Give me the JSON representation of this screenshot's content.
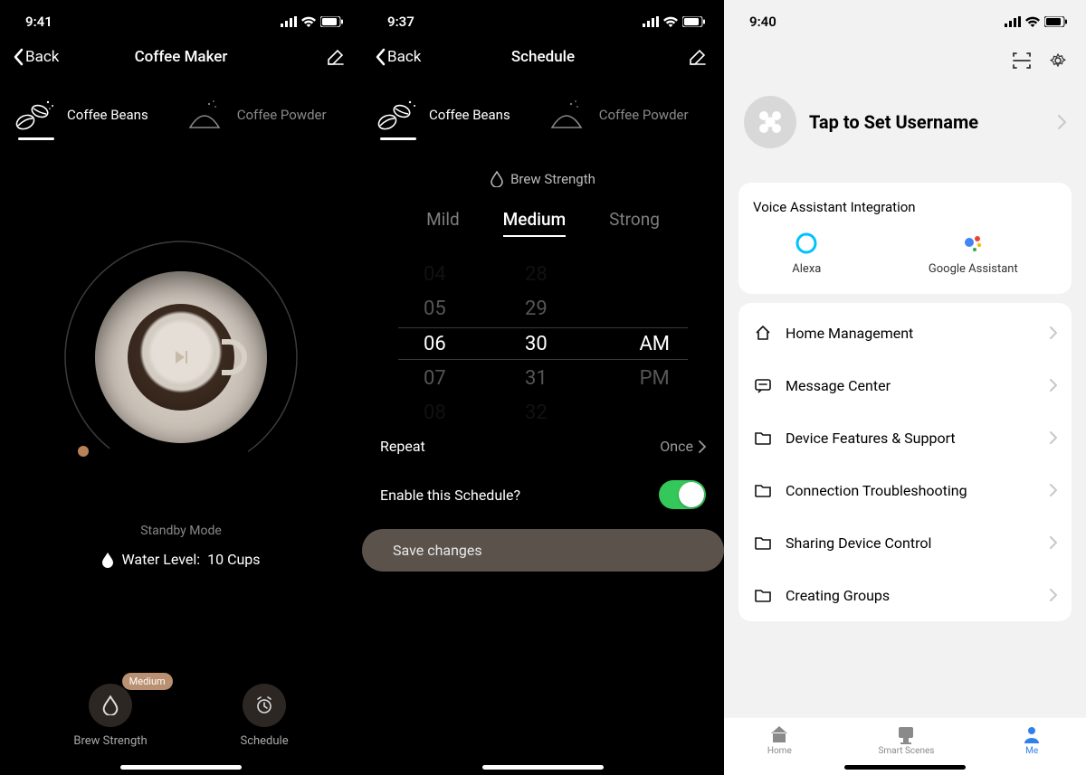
{
  "screens": {
    "coffee": {
      "time": "9:41",
      "back": "Back",
      "title": "Coffee Maker",
      "type_tabs": {
        "beans": "Coffee Beans",
        "powder": "Coffee Powder",
        "active": "beans"
      },
      "status": "Standby Mode",
      "water_label": "Water Level:",
      "water_value": "10 Cups",
      "actions": {
        "brew": "Brew Strength",
        "brew_badge": "Medium",
        "schedule": "Schedule"
      }
    },
    "schedule": {
      "time": "9:37",
      "back": "Back",
      "title": "Schedule",
      "type_tabs": {
        "beans": "Coffee Beans",
        "powder": "Coffee Powder",
        "active": "beans"
      },
      "strength_label": "Brew Strength",
      "strengths": {
        "mild": "Mild",
        "medium": "Medium",
        "strong": "Strong",
        "active": "medium"
      },
      "picker": {
        "hours": [
          "04",
          "05",
          "06",
          "07",
          "08"
        ],
        "mins": [
          "28",
          "29",
          "30",
          "31",
          "32"
        ],
        "ampm": [
          "AM",
          "PM"
        ],
        "sel_hour": "06",
        "sel_min": "30",
        "sel_ampm": "AM"
      },
      "repeat_label": "Repeat",
      "repeat_value": "Once",
      "enable_label": "Enable this Schedule?",
      "enable_value": true,
      "save": "Save changes"
    },
    "me": {
      "time": "9:40",
      "profile_name": "Tap to Set Username",
      "voice_title": "Voice Assistant Integration",
      "assistants": {
        "alexa": "Alexa",
        "google": "Google Assistant"
      },
      "menu": {
        "home": "Home Management",
        "msg": "Message Center",
        "features": "Device Features & Support",
        "trouble": "Connection Troubleshooting",
        "share": "Sharing Device Control",
        "groups": "Creating Groups"
      },
      "tabs": {
        "home": "Home",
        "scenes": "Smart Scenes",
        "me": "Me",
        "active": "me"
      }
    }
  }
}
